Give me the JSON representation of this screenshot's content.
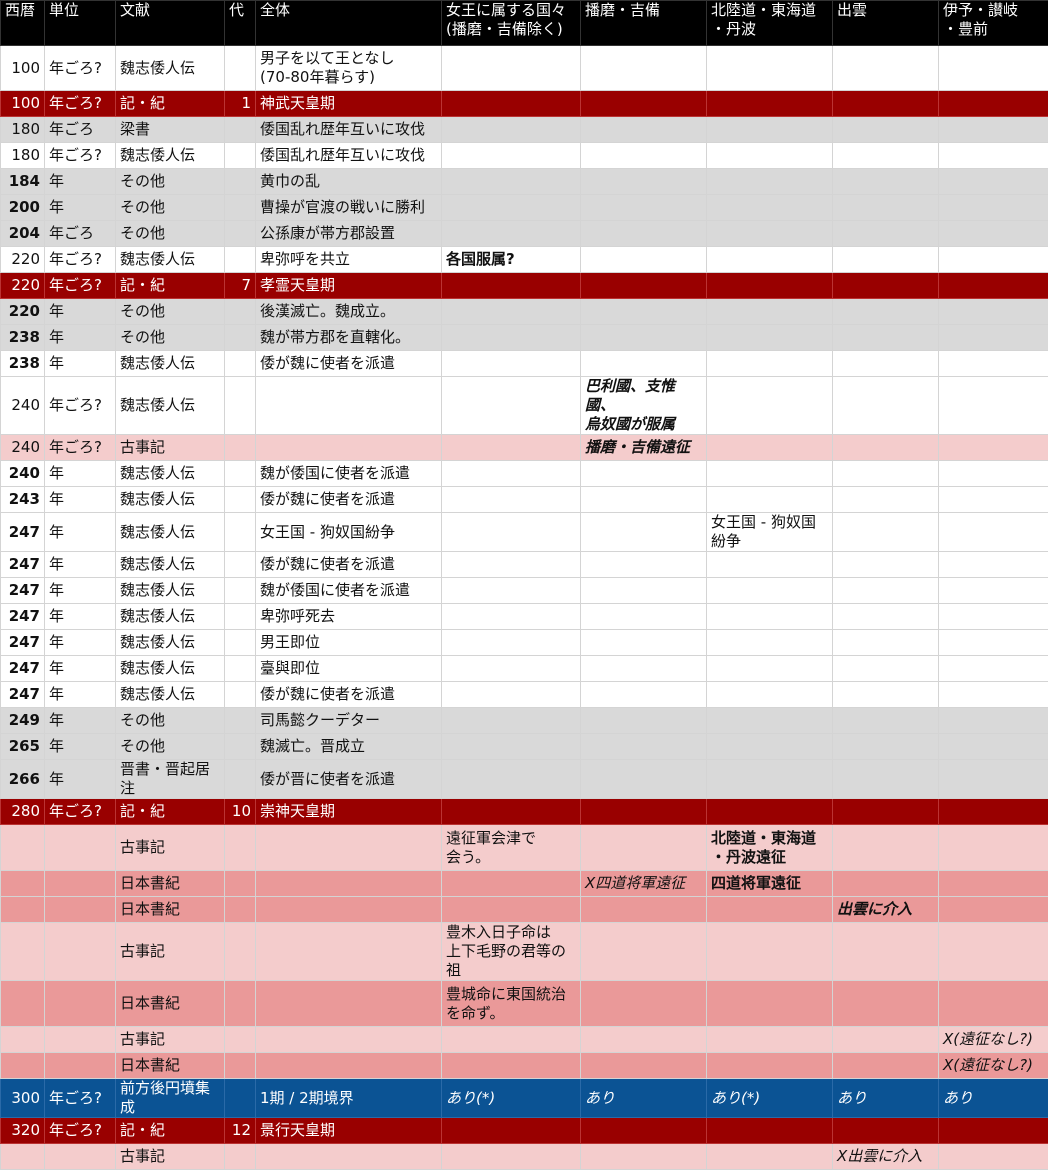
{
  "columns": [
    "西暦",
    "単位",
    "文献",
    "代",
    "全体",
    "女王に属する国々\n(播磨・吉備除く)",
    "播磨・吉備",
    "北陸道・東海道\n・丹波",
    "出雲",
    "伊予・讃岐\n・豊前"
  ],
  "rows": [
    {
      "style": "white",
      "h": 45,
      "boldYear": false,
      "cells": [
        "100",
        "年ごろ?",
        "魏志倭人伝",
        "",
        "男子を以て王となし\n(70-80年暮らす)",
        "",
        "",
        "",
        "",
        ""
      ]
    },
    {
      "style": "reign",
      "h": 26,
      "boldYear": false,
      "cells": [
        "100",
        "年ごろ?",
        "記・紀",
        "1",
        "神武天皇期",
        "",
        "",
        "",
        "",
        ""
      ]
    },
    {
      "style": "gray",
      "h": 26,
      "boldYear": false,
      "cells": [
        "180",
        "年ごろ",
        "梁書",
        "",
        "倭国乱れ歴年互いに攻伐",
        "",
        "",
        "",
        "",
        ""
      ]
    },
    {
      "style": "white",
      "h": 26,
      "boldYear": false,
      "cells": [
        "180",
        "年ごろ?",
        "魏志倭人伝",
        "",
        "倭国乱れ歴年互いに攻伐",
        "",
        "",
        "",
        "",
        ""
      ]
    },
    {
      "style": "gray",
      "h": 26,
      "boldYear": true,
      "cells": [
        "184",
        "年",
        "その他",
        "",
        "黄巾の乱",
        "",
        "",
        "",
        "",
        ""
      ]
    },
    {
      "style": "gray",
      "h": 26,
      "boldYear": true,
      "cells": [
        "200",
        "年",
        "その他",
        "",
        "曹操が官渡の戦いに勝利",
        "",
        "",
        "",
        "",
        ""
      ]
    },
    {
      "style": "gray",
      "h": 26,
      "boldYear": true,
      "cells": [
        "204",
        "年ごろ",
        "その他",
        "",
        "公孫康が帯方郡設置",
        "",
        "",
        "",
        "",
        ""
      ]
    },
    {
      "style": "white",
      "h": 26,
      "boldYear": false,
      "cells": [
        "220",
        "年ごろ?",
        "魏志倭人伝",
        "",
        "卑弥呼を共立",
        "各国服属?",
        "",
        "",
        "",
        ""
      ]
    },
    {
      "style": "reign",
      "h": 26,
      "boldYear": false,
      "cells": [
        "220",
        "年ごろ?",
        "記・紀",
        "7",
        "孝霊天皇期",
        "",
        "",
        "",
        "",
        ""
      ]
    },
    {
      "style": "gray",
      "h": 26,
      "boldYear": true,
      "cells": [
        "220",
        "年",
        "その他",
        "",
        "後漢滅亡。魏成立。",
        "",
        "",
        "",
        "",
        ""
      ]
    },
    {
      "style": "gray",
      "h": 26,
      "boldYear": true,
      "cells": [
        "238",
        "年",
        "その他",
        "",
        "魏が帯方郡を直轄化。",
        "",
        "",
        "",
        "",
        ""
      ]
    },
    {
      "style": "white",
      "h": 26,
      "boldYear": true,
      "cells": [
        "238",
        "年",
        "魏志倭人伝",
        "",
        "倭が魏に使者を派遣",
        "",
        "",
        "",
        "",
        ""
      ]
    },
    {
      "style": "white",
      "h": 46,
      "boldYear": false,
      "cells": [
        "240",
        "年ごろ?",
        "魏志倭人伝",
        "",
        "",
        "",
        "巴利國、支惟國、\n烏奴國が服属",
        "",
        "",
        ""
      ]
    },
    {
      "style": "lpink",
      "h": 26,
      "boldYear": false,
      "cells": [
        "240",
        "年ごろ?",
        "古事記",
        "",
        "",
        "",
        "播磨・吉備遠征",
        "",
        "",
        ""
      ]
    },
    {
      "style": "white",
      "h": 26,
      "boldYear": true,
      "cells": [
        "240",
        "年",
        "魏志倭人伝",
        "",
        "魏が倭国に使者を派遣",
        "",
        "",
        "",
        "",
        ""
      ]
    },
    {
      "style": "white",
      "h": 26,
      "boldYear": true,
      "cells": [
        "243",
        "年",
        "魏志倭人伝",
        "",
        "倭が魏に使者を派遣",
        "",
        "",
        "",
        "",
        ""
      ]
    },
    {
      "style": "white",
      "h": 26,
      "boldYear": true,
      "cells": [
        "247",
        "年",
        "魏志倭人伝",
        "",
        "女王国 - 狗奴国紛争",
        "",
        "",
        "女王国 - 狗奴国紛争",
        "",
        ""
      ]
    },
    {
      "style": "white",
      "h": 26,
      "boldYear": true,
      "cells": [
        "247",
        "年",
        "魏志倭人伝",
        "",
        "倭が魏に使者を派遣",
        "",
        "",
        "",
        "",
        ""
      ]
    },
    {
      "style": "white",
      "h": 26,
      "boldYear": true,
      "cells": [
        "247",
        "年",
        "魏志倭人伝",
        "",
        "魏が倭国に使者を派遣",
        "",
        "",
        "",
        "",
        ""
      ]
    },
    {
      "style": "white",
      "h": 26,
      "boldYear": true,
      "cells": [
        "247",
        "年",
        "魏志倭人伝",
        "",
        "卑弥呼死去",
        "",
        "",
        "",
        "",
        ""
      ]
    },
    {
      "style": "white",
      "h": 26,
      "boldYear": true,
      "cells": [
        "247",
        "年",
        "魏志倭人伝",
        "",
        "男王即位",
        "",
        "",
        "",
        "",
        ""
      ]
    },
    {
      "style": "white",
      "h": 26,
      "boldYear": true,
      "cells": [
        "247",
        "年",
        "魏志倭人伝",
        "",
        "臺與即位",
        "",
        "",
        "",
        "",
        ""
      ]
    },
    {
      "style": "white",
      "h": 26,
      "boldYear": true,
      "cells": [
        "247",
        "年",
        "魏志倭人伝",
        "",
        "倭が魏に使者を派遣",
        "",
        "",
        "",
        "",
        ""
      ]
    },
    {
      "style": "gray",
      "h": 26,
      "boldYear": true,
      "cells": [
        "249",
        "年",
        "その他",
        "",
        "司馬懿クーデター",
        "",
        "",
        "",
        "",
        ""
      ]
    },
    {
      "style": "gray",
      "h": 26,
      "boldYear": true,
      "cells": [
        "265",
        "年",
        "その他",
        "",
        "魏滅亡。晋成立",
        "",
        "",
        "",
        "",
        ""
      ]
    },
    {
      "style": "gray",
      "h": 26,
      "boldYear": true,
      "cells": [
        "266",
        "年",
        "晋書・晋起居注",
        "",
        "倭が晋に使者を派遣",
        "",
        "",
        "",
        "",
        ""
      ]
    },
    {
      "style": "reign",
      "h": 26,
      "boldYear": false,
      "cells": [
        "280",
        "年ごろ?",
        "記・紀",
        "10",
        "崇神天皇期",
        "",
        "",
        "",
        "",
        ""
      ]
    },
    {
      "style": "lpink",
      "h": 46,
      "boldYear": false,
      "cells": [
        "",
        "",
        "古事記",
        "",
        "",
        "遠征軍会津で\n会う。",
        "",
        "北陸道・東海道\n・丹波遠征",
        "",
        ""
      ]
    },
    {
      "style": "dpink",
      "h": 26,
      "boldYear": false,
      "cells": [
        "",
        "",
        "日本書紀",
        "",
        "",
        "",
        "X四道将軍遠征",
        "四道将軍遠征",
        "",
        ""
      ]
    },
    {
      "style": "dpink",
      "h": 26,
      "boldYear": false,
      "cells": [
        "",
        "",
        "日本書紀",
        "",
        "",
        "",
        "",
        "",
        "出雲に介入",
        ""
      ]
    },
    {
      "style": "lpink",
      "h": 46,
      "boldYear": false,
      "cells": [
        "",
        "",
        "古事記",
        "",
        "",
        "豊木入日子命は\n上下毛野の君等の祖",
        "",
        "",
        "",
        ""
      ]
    },
    {
      "style": "dpink",
      "h": 46,
      "boldYear": false,
      "cells": [
        "",
        "",
        "日本書紀",
        "",
        "",
        "豊城命に東国統治\nを命ず。",
        "",
        "",
        "",
        ""
      ]
    },
    {
      "style": "lpink",
      "h": 26,
      "boldYear": false,
      "cells": [
        "",
        "",
        "古事記",
        "",
        "",
        "",
        "",
        "",
        "",
        "X(遠征なし?)"
      ]
    },
    {
      "style": "dpink",
      "h": 26,
      "boldYear": false,
      "cells": [
        "",
        "",
        "日本書紀",
        "",
        "",
        "",
        "",
        "",
        "",
        "X(遠征なし?)"
      ]
    },
    {
      "style": "blue",
      "h": 26,
      "boldYear": false,
      "cells": [
        "300",
        "年ごろ?",
        "前方後円墳集成",
        "",
        "1期 / 2期境界",
        "あり(*)",
        "あり",
        "あり(*)",
        "あり",
        "あり"
      ]
    },
    {
      "style": "reign",
      "h": 26,
      "boldYear": false,
      "cells": [
        "320",
        "年ごろ?",
        "記・紀",
        "12",
        "景行天皇期",
        "",
        "",
        "",
        "",
        ""
      ]
    },
    {
      "style": "lpink",
      "h": 26,
      "boldYear": false,
      "cells": [
        "",
        "",
        "古事記",
        "",
        "",
        "",
        "",
        "",
        "X出雲に介入",
        ""
      ]
    }
  ],
  "formats": {
    "7-5": "b",
    "12-6": "b i",
    "13-6": "b i",
    "27-7": "b",
    "28-6": "i",
    "28-7": "b",
    "29-8": "b i",
    "32-9": "i",
    "33-9": "i",
    "34-5": "i",
    "34-6": "i",
    "34-7": "i",
    "34-8": "i",
    "34-9": "i",
    "36-8": "i"
  }
}
